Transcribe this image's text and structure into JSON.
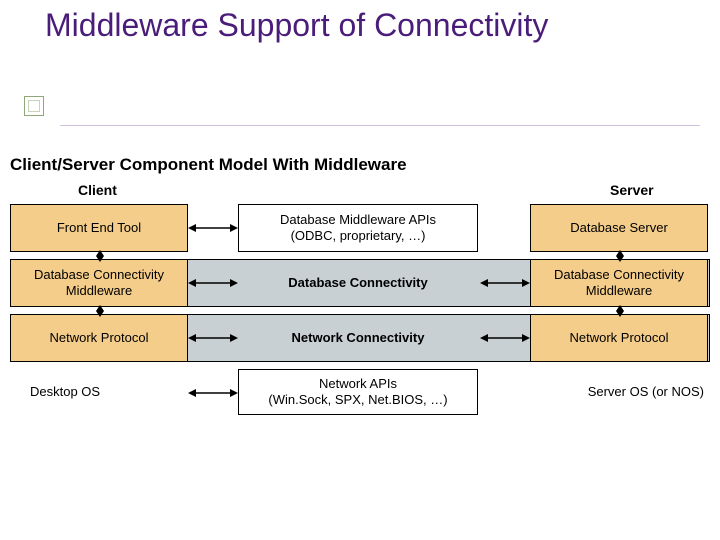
{
  "slide": {
    "title": "Middleware Support of Connectivity"
  },
  "diagram": {
    "subtitle": "Client/Server Component Model With Middleware",
    "columns": {
      "client": "Client",
      "server": "Server"
    },
    "rows": {
      "r1": {
        "left": "Front End Tool",
        "mid": "Database Middleware APIs\n(ODBC, proprietary, …)",
        "right": "Database Server"
      },
      "r2": {
        "left": "Database Connectivity\nMiddleware",
        "mid": "Database Connectivity",
        "right": "Database Connectivity\nMiddleware"
      },
      "r3": {
        "left": "Network Protocol",
        "mid": "Network Connectivity",
        "right": "Network Protocol"
      },
      "r4": {
        "left": "Desktop OS",
        "mid": "Network APIs\n(Win.Sock, SPX, Net.BIOS, …)",
        "right": "Server OS (or NOS)"
      }
    }
  }
}
